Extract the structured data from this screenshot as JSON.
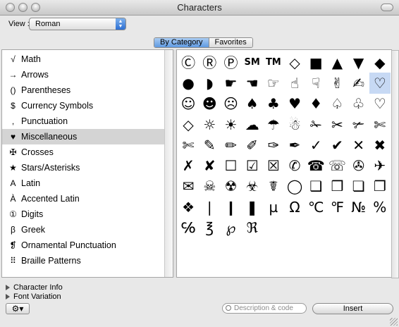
{
  "window": {
    "title": "Characters"
  },
  "view": {
    "label": "View :",
    "selected": "Roman"
  },
  "tabs": {
    "by_category": "By Category",
    "favorites": "Favorites"
  },
  "categories": [
    {
      "icon": "√",
      "label": "Math"
    },
    {
      "icon": "→",
      "label": "Arrows"
    },
    {
      "icon": "()",
      "label": "Parentheses"
    },
    {
      "icon": "$",
      "label": "Currency Symbols"
    },
    {
      "icon": ",",
      "label": "Punctuation"
    },
    {
      "icon": "♥",
      "label": "Miscellaneous"
    },
    {
      "icon": "✠",
      "label": "Crosses"
    },
    {
      "icon": "★",
      "label": "Stars/Asterisks"
    },
    {
      "icon": "A",
      "label": "Latin"
    },
    {
      "icon": "À",
      "label": "Accented Latin"
    },
    {
      "icon": "①",
      "label": "Digits"
    },
    {
      "icon": "β",
      "label": "Greek"
    },
    {
      "icon": "❡",
      "label": "Ornamental Punctuation"
    },
    {
      "icon": "⠿",
      "label": "Braille Patterns"
    }
  ],
  "selected_category": "Miscellaneous",
  "characters": [
    "Ⓒ",
    "Ⓡ",
    "Ⓟ",
    "SM",
    "TM",
    "◇",
    "■",
    "▲",
    "▼",
    "◆",
    "●",
    "◗",
    "☛",
    "☚",
    "☞",
    "☝",
    "☟",
    "✌",
    "✍",
    "♡",
    "☺",
    "☻",
    "☹",
    "♠",
    "♣",
    "♥",
    "♦",
    "♤",
    "♧",
    "♡",
    "◇",
    "☼",
    "☀",
    "☁",
    "☂",
    "☃",
    "✁",
    "✂",
    "✃",
    "✄",
    "✄",
    "✎",
    "✏",
    "✐",
    "✑",
    "✒",
    "✓",
    "✔",
    "✕",
    "✖",
    "✗",
    "✘",
    "☐",
    "☑",
    "☒",
    "✆",
    "☎",
    "☏",
    "✇",
    "✈",
    "✉",
    "☠",
    "☢",
    "☣",
    "☤",
    "◯",
    "❑",
    "❒",
    "❏",
    "❐",
    "❖",
    "❘",
    "❙",
    "❚",
    "µ",
    "Ω",
    "℃",
    "℉",
    "№",
    "%",
    "℅",
    "℥",
    "℘",
    "ℜ"
  ],
  "selected_character_index": 19,
  "info": {
    "character_info": "Character Info",
    "font_variation": "Font Variation"
  },
  "search": {
    "placeholder": "Description & code"
  },
  "buttons": {
    "insert": "Insert",
    "gear": "⚙▾"
  }
}
